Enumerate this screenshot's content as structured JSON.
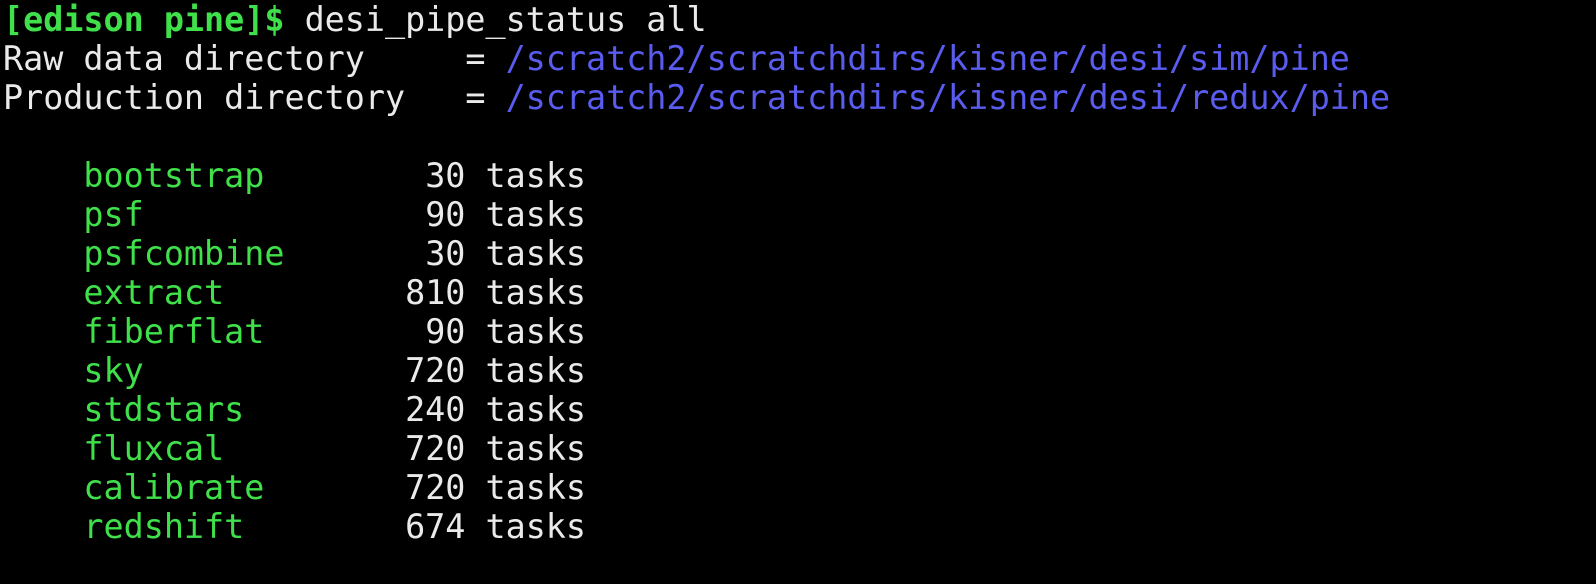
{
  "terminal": {
    "prompt": "[edison pine]$",
    "command": "desi_pipe_status all",
    "raw_label": "Raw data directory     = ",
    "raw_path": "/scratch2/scratchdirs/kisner/desi/sim/pine",
    "prod_label": "Production directory   = ",
    "prod_path": "/scratch2/scratchdirs/kisner/desi/redux/pine",
    "stages": [
      {
        "name": "bootstrap",
        "count": "30",
        "unit": "tasks"
      },
      {
        "name": "psf",
        "count": "90",
        "unit": "tasks"
      },
      {
        "name": "psfcombine",
        "count": "30",
        "unit": "tasks"
      },
      {
        "name": "extract",
        "count": "810",
        "unit": "tasks"
      },
      {
        "name": "fiberflat",
        "count": "90",
        "unit": "tasks"
      },
      {
        "name": "sky",
        "count": "720",
        "unit": "tasks"
      },
      {
        "name": "stdstars",
        "count": "240",
        "unit": "tasks"
      },
      {
        "name": "fluxcal",
        "count": "720",
        "unit": "tasks"
      },
      {
        "name": "calibrate",
        "count": "720",
        "unit": "tasks"
      },
      {
        "name": "redshift",
        "count": "674",
        "unit": "tasks"
      }
    ],
    "colors": {
      "background": "#000000",
      "text": "#eaeaea",
      "prompt": "#3fe04a",
      "path": "#5a5cf0",
      "stage": "#3fe04a"
    }
  }
}
